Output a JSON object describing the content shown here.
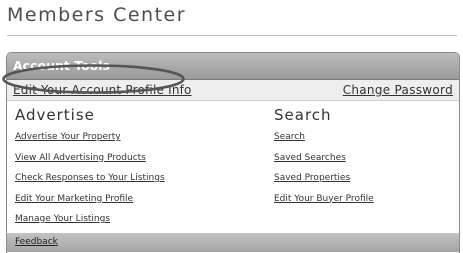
{
  "page": {
    "title": "Members Center"
  },
  "panel": {
    "header": "Account Tools",
    "edit_profile": "Edit Your Account Profile Info",
    "change_password": "Change Password"
  },
  "advertise": {
    "heading": "Advertise",
    "links": [
      "Advertise Your Property",
      "View All Advertising Products",
      "Check Responses to Your Listings",
      "Edit Your Marketing Profile",
      "Manage Your Listings"
    ]
  },
  "search": {
    "heading": "Search",
    "links": [
      "Search",
      "Saved Searches",
      "Saved Properties",
      "Edit Your Buyer Profile"
    ]
  },
  "footer": {
    "feedback": "Feedback"
  },
  "colors": {
    "header_bg": "#a8a8a8",
    "text": "#333333",
    "row_bg": "#eeeeee"
  }
}
